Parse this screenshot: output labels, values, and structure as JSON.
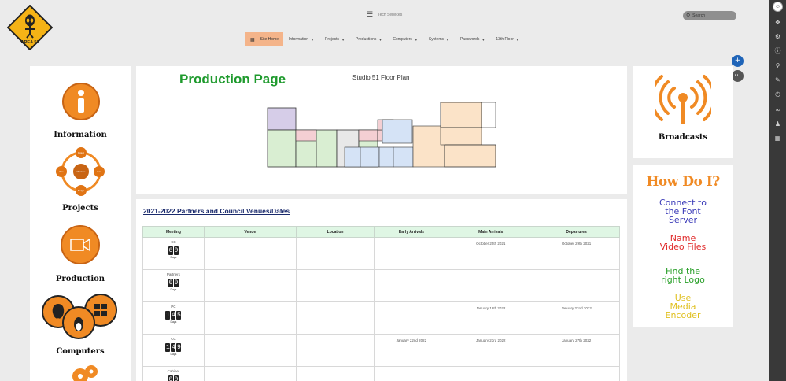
{
  "logo": {
    "text": "AREA 51"
  },
  "brand": {
    "text": "Tech Services"
  },
  "search": {
    "placeholder": "Search"
  },
  "nav": {
    "items": [
      {
        "label": "Site Home"
      },
      {
        "label": "Information"
      },
      {
        "label": "Projects"
      },
      {
        "label": "Productions"
      },
      {
        "label": "Computers"
      },
      {
        "label": "Systems"
      },
      {
        "label": "Passwords"
      },
      {
        "label": "13th Floor"
      }
    ]
  },
  "left_blocks": {
    "information": "Information",
    "projects": "Projects",
    "production": "Production",
    "computers": "Computers",
    "project_nodes": [
      "Project",
      "Time",
      "Milestone",
      "Cost",
      "Budget"
    ]
  },
  "main": {
    "page_title": "Production Page",
    "floor_plan_title": "Studio 51 Floor Plan"
  },
  "table": {
    "title": "2021-2022 Partners and Council Venues/Dates",
    "headers": [
      "Meeting",
      "Venue",
      "Location",
      "Early Arrivals",
      "Main Arrivals",
      "Departures"
    ],
    "days_label": "Days",
    "rows": [
      {
        "meeting": "CC",
        "days": "60",
        "venue": "",
        "location": "",
        "early": "",
        "main": "October 25th 2021",
        "depart": "October 29th 2021"
      },
      {
        "meeting": "Partners",
        "days": "00",
        "venue": "",
        "location": "",
        "early": "",
        "main": "",
        "depart": ""
      },
      {
        "meeting": "PC",
        "days": "145",
        "venue": "",
        "location": "",
        "early": "",
        "main": "January 18th 2022",
        "depart": "January 22nd 2022"
      },
      {
        "meeting": "CC",
        "days": "149",
        "venue": "",
        "location": "",
        "early": "January 22nd 2022",
        "main": "January 23rd 2022",
        "depart": "January 27th 2022"
      },
      {
        "meeting": "Cabinet",
        "days": "00",
        "venue": "",
        "location": "",
        "early": "",
        "main": "",
        "depart": ""
      }
    ]
  },
  "right": {
    "broadcasts": "Broadcasts",
    "howdoi_title": "How Do I?",
    "links": [
      {
        "text": "Connect to the Font Server",
        "color": "#3a3ab8"
      },
      {
        "text": "Name Video Files",
        "color": "#e02a2a"
      },
      {
        "text": "Find the right Logo",
        "color": "#2aa02a"
      },
      {
        "text": "Use Media Encoder",
        "color": "#e0c020"
      }
    ]
  },
  "colors": {
    "accent": "#f08a24",
    "nav_active": "#f4b48a",
    "title_green": "#1e9a2d",
    "fab_blue": "#1f64b8"
  }
}
